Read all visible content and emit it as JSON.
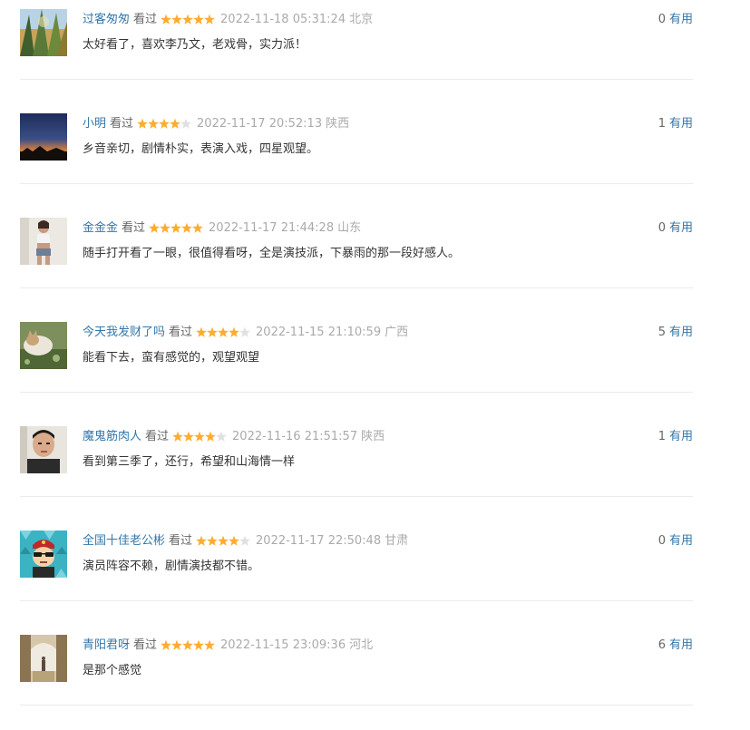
{
  "comments": [
    {
      "username": "过客匆匆",
      "watched": "看过",
      "rating": 5,
      "time": "2022-11-18 05:31:24",
      "location": "北京",
      "useful_count": "0",
      "useful_label": "有用",
      "content": "太好看了，喜欢李乃文，老戏骨，实力派！",
      "avatar": "trees-photo"
    },
    {
      "username": "小明",
      "watched": "看过",
      "rating": 4,
      "time": "2022-11-17 20:52:13",
      "location": "陕西",
      "useful_count": "1",
      "useful_label": "有用",
      "content": "乡音亲切，剧情朴实，表演入戏，四星观望。",
      "avatar": "sunset-photo"
    },
    {
      "username": "金金金",
      "watched": "看过",
      "rating": 5,
      "time": "2022-11-17 21:44:28",
      "location": "山东",
      "useful_count": "0",
      "useful_label": "有用",
      "content": "随手打开看了一眼，很值得看呀，全是演技派，下暴雨的那一段好感人。",
      "avatar": "person-photo"
    },
    {
      "username": "今天我发财了吗",
      "watched": "看过",
      "rating": 4,
      "time": "2022-11-15 21:10:59",
      "location": "广西",
      "useful_count": "5",
      "useful_label": "有用",
      "content": "能看下去，蛮有感觉的，观望观望",
      "avatar": "cat-photo"
    },
    {
      "username": "魔鬼筋肉人",
      "watched": "看过",
      "rating": 4,
      "time": "2022-11-16 21:51:57",
      "location": "陕西",
      "useful_count": "1",
      "useful_label": "有用",
      "content": "看到第三季了，还行，希望和山海情一样",
      "avatar": "face-photo"
    },
    {
      "username": "全国十佳老公彬",
      "watched": "看过",
      "rating": 4,
      "time": "2022-11-17 22:50:48",
      "location": "甘肃",
      "useful_count": "0",
      "useful_label": "有用",
      "content": "演员阵容不赖，剧情演技都不错。",
      "avatar": "cartoon-avatar"
    },
    {
      "username": "青阳君呀",
      "watched": "看过",
      "rating": 5,
      "time": "2022-11-15 23:09:36",
      "location": "河北",
      "useful_count": "6",
      "useful_label": "有用",
      "content": "是那个感觉",
      "avatar": "hall-photo"
    }
  ]
}
